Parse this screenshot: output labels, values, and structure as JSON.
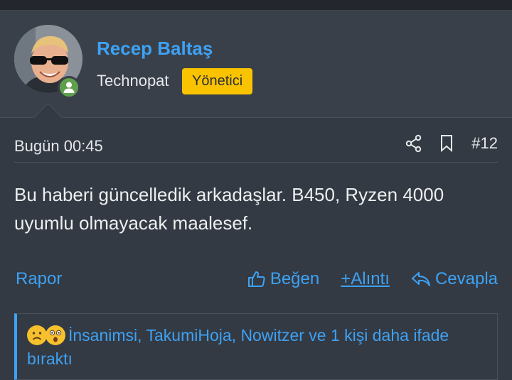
{
  "user": {
    "name": "Recep Baltaş",
    "title": "Technopat",
    "role": "Yönetici",
    "avatar_icon": "avatar-photo",
    "status_icon": "online-user-icon",
    "status_color": "#5fa04e"
  },
  "post": {
    "time": "Bugün 00:45",
    "number": "#12",
    "share_icon": "share-icon",
    "bookmark_icon": "bookmark-icon",
    "message": "Bu haberi güncelledik arkadaşlar. B450, Ryzen 4000 uyumlu olmayacak maalesef."
  },
  "actions": {
    "report": "Rapor",
    "like": "Beğen",
    "quote_plus": "+",
    "quote": "Alıntı",
    "reply": "Cevapla"
  },
  "reactions": {
    "icons": [
      "sad-face-icon",
      "astonished-face-icon"
    ],
    "text": "İnsanimsi, TakumiHoja, Nowitzer ve 1 kişi daha ifade bıraktı"
  },
  "colors": {
    "accent": "#3da2f5",
    "badge": "#f9c300",
    "background": "#343a43"
  }
}
